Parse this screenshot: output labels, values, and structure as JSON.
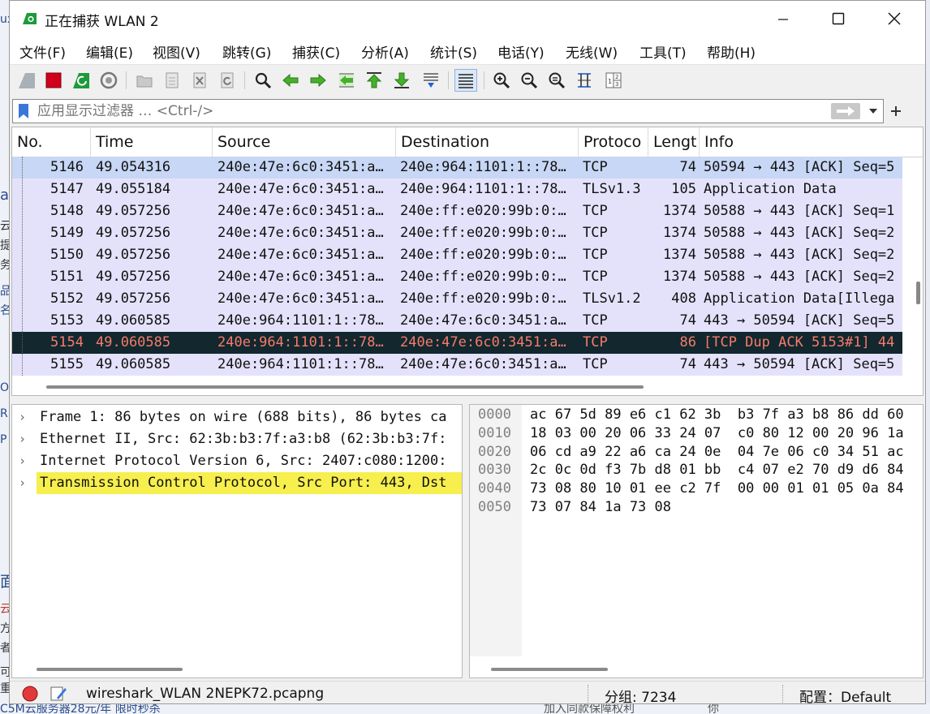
{
  "window": {
    "title": "正在捕获 WLAN 2"
  },
  "menu": [
    "文件(F)",
    "编辑(E)",
    "视图(V)",
    "跳转(G)",
    "捕获(C)",
    "分析(A)",
    "统计(S)",
    "电话(Y)",
    "无线(W)",
    "工具(T)",
    "帮助(H)"
  ],
  "toolbar_icons": [
    "shark-fin-start-icon",
    "stop-capture-icon",
    "restart-capture-icon",
    "capture-options-icon",
    "open-file-icon",
    "save-file-icon",
    "close-file-icon",
    "reload-file-icon",
    "find-packet-icon",
    "go-back-icon",
    "go-forward-icon",
    "go-to-packet-icon",
    "first-packet-icon",
    "last-packet-icon",
    "autoscroll-icon",
    "colorize-icon",
    "zoom-in-icon",
    "zoom-out-icon",
    "normal-size-icon",
    "resize-columns-icon",
    "layout-icon"
  ],
  "filter": {
    "placeholder": "应用显示过滤器 … <Ctrl-/>"
  },
  "columns": [
    "No.",
    "Time",
    "Source",
    "Destination",
    "Protoco",
    "Lengt",
    "Info"
  ],
  "packets": [
    {
      "no": "5146",
      "time": "49.054316",
      "src": "240e:47e:6c0:3451:a…",
      "dst": "240e:964:1101:1::78…",
      "proto": "TCP",
      "len": "74",
      "info": "50594 → 443 [ACK] Seq=5",
      "bg": "#c7d7f5",
      "fg": "#111111"
    },
    {
      "no": "5147",
      "time": "49.055184",
      "src": "240e:47e:6c0:3451:a…",
      "dst": "240e:964:1101:1::78…",
      "proto": "TLSv1.3",
      "len": "105",
      "info": "Application Data",
      "bg": "#e4e2fb",
      "fg": "#111111"
    },
    {
      "no": "5148",
      "time": "49.057256",
      "src": "240e:47e:6c0:3451:a…",
      "dst": "240e:ff:e020:99b:0:…",
      "proto": "TCP",
      "len": "1374",
      "info": "50588 → 443 [ACK] Seq=1",
      "bg": "#e4e2fb",
      "fg": "#111111"
    },
    {
      "no": "5149",
      "time": "49.057256",
      "src": "240e:47e:6c0:3451:a…",
      "dst": "240e:ff:e020:99b:0:…",
      "proto": "TCP",
      "len": "1374",
      "info": "50588 → 443 [ACK] Seq=2",
      "bg": "#e4e2fb",
      "fg": "#111111"
    },
    {
      "no": "5150",
      "time": "49.057256",
      "src": "240e:47e:6c0:3451:a…",
      "dst": "240e:ff:e020:99b:0:…",
      "proto": "TCP",
      "len": "1374",
      "info": "50588 → 443 [ACK] Seq=2",
      "bg": "#e4e2fb",
      "fg": "#111111"
    },
    {
      "no": "5151",
      "time": "49.057256",
      "src": "240e:47e:6c0:3451:a…",
      "dst": "240e:ff:e020:99b:0:…",
      "proto": "TCP",
      "len": "1374",
      "info": "50588 → 443 [ACK] Seq=2",
      "bg": "#e4e2fb",
      "fg": "#111111"
    },
    {
      "no": "5152",
      "time": "49.057256",
      "src": "240e:47e:6c0:3451:a…",
      "dst": "240e:ff:e020:99b:0:…",
      "proto": "TLSv1.2",
      "len": "408",
      "info": "Application Data[Illega",
      "bg": "#e4e2fb",
      "fg": "#111111"
    },
    {
      "no": "5153",
      "time": "49.060585",
      "src": "240e:964:1101:1::78…",
      "dst": "240e:47e:6c0:3451:a…",
      "proto": "TCP",
      "len": "74",
      "info": "443 → 50594 [ACK] Seq=5",
      "bg": "#e4e2fb",
      "fg": "#111111"
    },
    {
      "no": "5154",
      "time": "49.060585",
      "src": "240e:964:1101:1::78…",
      "dst": "240e:47e:6c0:3451:a…",
      "proto": "TCP",
      "len": "86",
      "info": "[TCP Dup ACK 5153#1] 44",
      "bg": "#12272e",
      "fg": "#f77b6b"
    },
    {
      "no": "5155",
      "time": "49.060585",
      "src": "240e:964:1101:1::78…",
      "dst": "240e:47e:6c0:3451:a…",
      "proto": "TCP",
      "len": "74",
      "info": "443 → 50594 [ACK] Seq=5",
      "bg": "#e4e2fb",
      "fg": "#111111"
    }
  ],
  "details": [
    {
      "text": "Frame 1: 86 bytes on wire (688 bits), 86 bytes ca",
      "selected": false
    },
    {
      "text": "Ethernet II, Src: 62:3b:b3:7f:a3:b8 (62:3b:b3:7f:",
      "selected": false
    },
    {
      "text": "Internet Protocol Version 6, Src: 2407:c080:1200:",
      "selected": false
    },
    {
      "text": "Transmission Control Protocol, Src Port: 443, Dst",
      "selected": true
    }
  ],
  "bytes": [
    {
      "offset": "0000",
      "hex": "ac 67 5d 89 e6 c1 62 3b  b3 7f a3 b8 86 dd 60"
    },
    {
      "offset": "0010",
      "hex": "18 03 00 20 06 33 24 07  c0 80 12 00 20 96 1a"
    },
    {
      "offset": "0020",
      "hex": "06 cd a9 22 a6 ca 24 0e  04 7e 06 c0 34 51 ac"
    },
    {
      "offset": "0030",
      "hex": "2c 0c 0d f3 7b d8 01 bb  c4 07 e2 70 d9 d6 84"
    },
    {
      "offset": "0040",
      "hex": "73 08 80 10 01 ee c2 7f  00 00 01 01 05 0a 84"
    },
    {
      "offset": "0050",
      "hex": "73 07 84 1a 73 08"
    }
  ],
  "status": {
    "file": "wireshark_WLAN 2NEPK72.pcapng",
    "packets": "分组: 7234",
    "profile": "配置：Default"
  },
  "background_fragments": [
    "ux",
    "al",
    "云",
    "提",
    "务",
    "品",
    "名",
    "OS",
    "RD",
    "P",
    "面",
    "云",
    "方",
    "者",
    "可重"
  ],
  "background_bottom": [
    "C5M云服务器28元/年 限时秒杀",
    "加入同款保障权利",
    "你"
  ],
  "colors": {
    "selected_row": "#c7d7f5",
    "row": "#e4e2fb",
    "marked_bg": "#12272e",
    "marked_fg": "#f77b6b",
    "detail_highlight": "#f6ef4d"
  }
}
